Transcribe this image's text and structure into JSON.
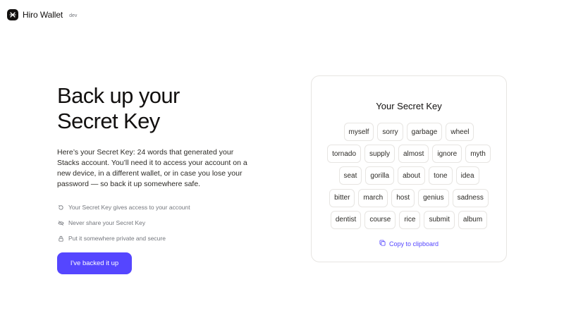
{
  "header": {
    "brand": "Hiro Wallet",
    "env": "dev"
  },
  "main": {
    "title_line1": "Back up your",
    "title_line2": "Secret Key",
    "intro": "Here’s your Secret Key: 24 words that generated your Stacks account. You’ll need it to access your account on a new device, in a different wallet, or in case you lose your password — so back it up somewhere safe.",
    "bullets": [
      {
        "icon": "rotate-icon",
        "text": "Your Secret Key gives access to your account"
      },
      {
        "icon": "eye-off-icon",
        "text": "Never share your Secret Key"
      },
      {
        "icon": "lock-icon",
        "text": "Put it somewhere private and secure"
      }
    ],
    "cta_label": "I've backed it up"
  },
  "card": {
    "title": "Your Secret Key",
    "words": [
      [
        "myself",
        "sorry",
        "garbage",
        "wheel"
      ],
      [
        "tornado",
        "supply",
        "almost",
        "ignore",
        "myth"
      ],
      [
        "seat",
        "gorilla",
        "about",
        "tone",
        "idea"
      ],
      [
        "bitter",
        "march",
        "host",
        "genius",
        "sadness"
      ],
      [
        "dentist",
        "course",
        "rice",
        "submit",
        "album"
      ]
    ],
    "copy_label": "Copy to clipboard"
  },
  "colors": {
    "accent": "#5546ff",
    "text": "#12100f",
    "muted": "#74777d",
    "border": "#e7e5e2"
  }
}
